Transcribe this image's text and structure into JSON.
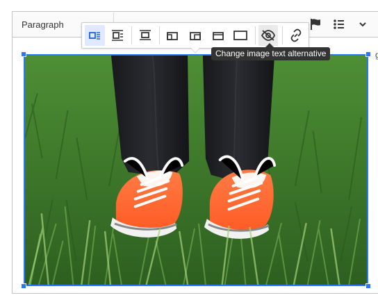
{
  "toolbar": {
    "heading_value": "Paragraph"
  },
  "image_toolbar": {
    "tooltip": "Change image text alternative",
    "tools": [
      "inline-left-icon",
      "left-aligned-icon",
      "centered-icon",
      "side-image-icon",
      "full-width-icon",
      "wrapped-icon",
      "original-size-icon",
      "text-alternative-icon",
      "link-icon"
    ]
  },
  "colors": {
    "accent": "#2977ff",
    "tooltip_bg": "#333333",
    "active_tool_bg": "#dfe9ff",
    "grass_dark": "#2f5f22",
    "grass_light": "#6ea84b",
    "shoe_orange": "#ff6a33",
    "jeans": "#1e2024"
  },
  "edge_text": "g"
}
